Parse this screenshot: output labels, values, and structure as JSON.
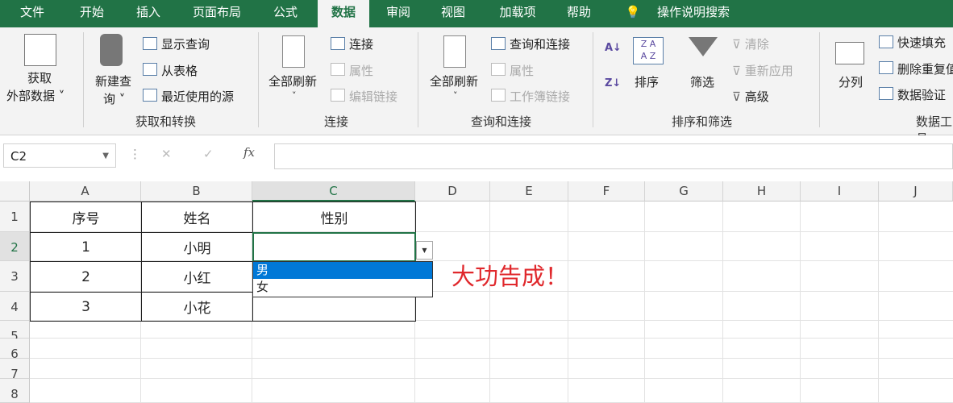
{
  "tabs": [
    "文件",
    "开始",
    "插入",
    "页面布局",
    "公式",
    "数据",
    "审阅",
    "视图",
    "加载项",
    "帮助"
  ],
  "tell_me": "操作说明搜索",
  "ribbon": {
    "get_external": [
      "获取",
      "外部数据 ˅"
    ],
    "new_query": [
      "新建查",
      "询 ˅"
    ],
    "show_queries": "显示查询",
    "from_table": "从表格",
    "recent_sources": "最近使用的源",
    "group_get_transform": "获取和转换",
    "refresh_all": "全部刷新",
    "connections": "连接",
    "properties": "属性",
    "edit_links": "编辑链接",
    "group_connections": "连接",
    "refresh_all2": "全部刷新",
    "queries_connections": "查询和连接",
    "properties2": "属性",
    "workbook_links": "工作簿链接",
    "group_queries": "查询和连接",
    "sort": "排序",
    "filter": "筛选",
    "clear": "清除",
    "reapply": "重新应用",
    "advanced": "高级",
    "group_sort_filter": "排序和筛选",
    "text_to_columns": "分列",
    "flash_fill": "快速填充",
    "remove_duplicates": "删除重复值",
    "data_validation": "数据验证",
    "group_data_tools": "数据工具"
  },
  "formula_bar": {
    "name_box": "C2",
    "fx": "fx",
    "cancel": "✕",
    "enter": "✓",
    "value": ""
  },
  "columns": [
    "A",
    "B",
    "C",
    "D",
    "E",
    "F",
    "G",
    "H",
    "I",
    "J"
  ],
  "rows": [
    "1",
    "2",
    "3",
    "4",
    "5",
    "6",
    "7",
    "8"
  ],
  "table": {
    "headers": [
      "序号",
      "姓名",
      "性别"
    ],
    "data": [
      [
        "1",
        "小明",
        ""
      ],
      [
        "2",
        "小红",
        ""
      ],
      [
        "3",
        "小花",
        ""
      ]
    ]
  },
  "dropdown": {
    "options": [
      "男",
      "女"
    ],
    "selected": "男"
  },
  "annotation": "大功告成！"
}
